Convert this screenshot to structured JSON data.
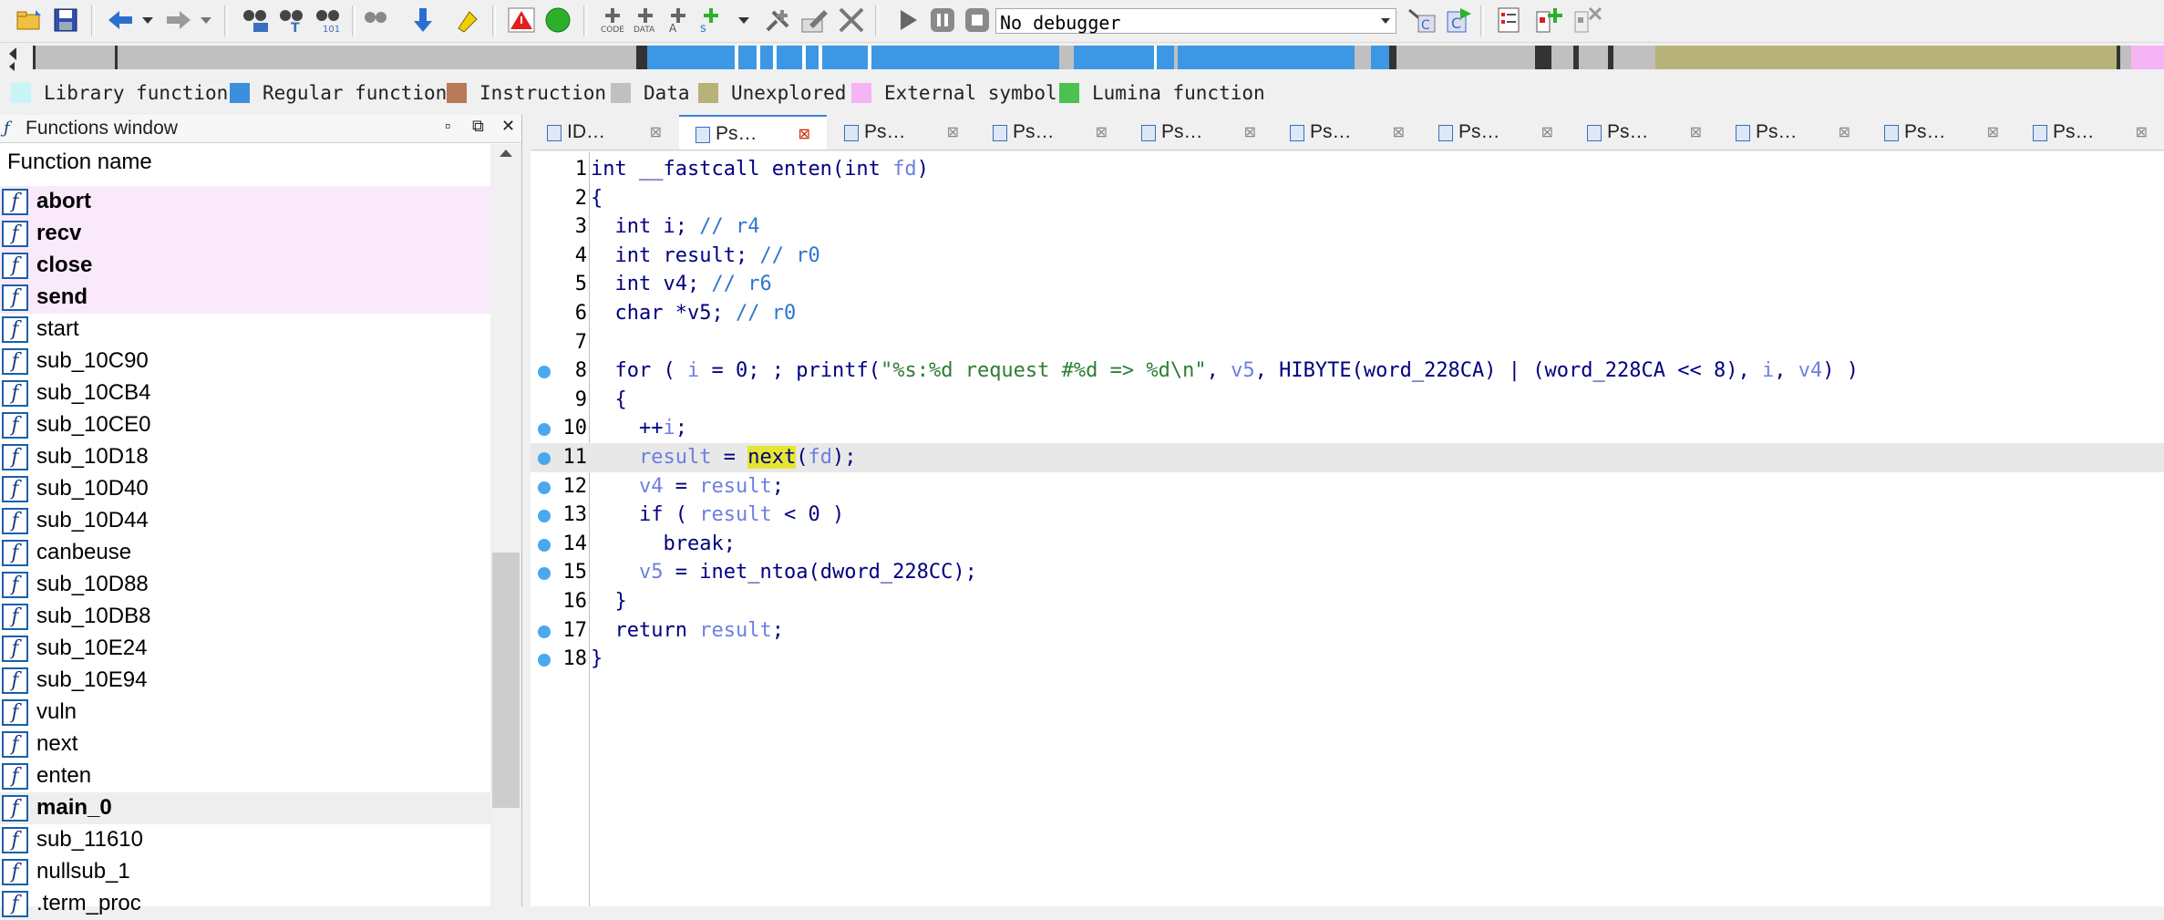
{
  "toolbar": {
    "debugger_select": "No debugger"
  },
  "legend": [
    {
      "label": "Library function",
      "color": "#c8f5f5"
    },
    {
      "label": "Regular function",
      "color": "#3c8fdc"
    },
    {
      "label": "Instruction",
      "color": "#b97a57"
    },
    {
      "label": "Data",
      "color": "#c0c0c0"
    },
    {
      "label": "Unexplored",
      "color": "#b7b27a"
    },
    {
      "label": "External symbol",
      "color": "#f5b5f5"
    },
    {
      "label": "Lumina function",
      "color": "#4cc050"
    }
  ],
  "functions_window": {
    "title": "Functions window",
    "column_header": "Function name",
    "items": [
      {
        "name": "abort",
        "style": "external"
      },
      {
        "name": "recv",
        "style": "external"
      },
      {
        "name": "close",
        "style": "external"
      },
      {
        "name": "send",
        "style": "external"
      },
      {
        "name": "start",
        "style": "normal"
      },
      {
        "name": "sub_10C90",
        "style": "normal"
      },
      {
        "name": "sub_10CB4",
        "style": "normal"
      },
      {
        "name": "sub_10CE0",
        "style": "normal"
      },
      {
        "name": "sub_10D18",
        "style": "normal"
      },
      {
        "name": "sub_10D40",
        "style": "normal"
      },
      {
        "name": "sub_10D44",
        "style": "normal"
      },
      {
        "name": "canbeuse",
        "style": "normal"
      },
      {
        "name": "sub_10D88",
        "style": "normal"
      },
      {
        "name": "sub_10DB8",
        "style": "normal"
      },
      {
        "name": "sub_10E24",
        "style": "normal"
      },
      {
        "name": "sub_10E94",
        "style": "normal"
      },
      {
        "name": "vuln",
        "style": "normal"
      },
      {
        "name": "next",
        "style": "normal"
      },
      {
        "name": "enten",
        "style": "normal"
      },
      {
        "name": "main_0",
        "style": "selected"
      },
      {
        "name": "sub_11610",
        "style": "normal"
      },
      {
        "name": "nullsub_1",
        "style": "normal"
      },
      {
        "name": ".term_proc",
        "style": "normal"
      }
    ]
  },
  "tabs": [
    {
      "label": "ID…",
      "active": false
    },
    {
      "label": "Ps…",
      "active": true
    },
    {
      "label": "Ps…",
      "active": false
    },
    {
      "label": "Ps…",
      "active": false
    },
    {
      "label": "Ps…",
      "active": false
    },
    {
      "label": "Ps…",
      "active": false
    },
    {
      "label": "Ps…",
      "active": false
    },
    {
      "label": "Ps…",
      "active": false
    },
    {
      "label": "Ps…",
      "active": false
    },
    {
      "label": "Ps…",
      "active": false
    },
    {
      "label": "Ps…",
      "active": false
    }
  ],
  "code": {
    "current_line": 11,
    "lines": [
      {
        "n": "1",
        "dot": false,
        "text": "int __fastcall enten(int fd)"
      },
      {
        "n": "2",
        "dot": false,
        "text": "{"
      },
      {
        "n": "3",
        "dot": false,
        "text": "  int i; // r4"
      },
      {
        "n": "4",
        "dot": false,
        "text": "  int result; // r0"
      },
      {
        "n": "5",
        "dot": false,
        "text": "  int v4; // r6"
      },
      {
        "n": "6",
        "dot": false,
        "text": "  char *v5; // r0"
      },
      {
        "n": "7",
        "dot": false,
        "text": ""
      },
      {
        "n": "8",
        "dot": true,
        "text": "  for ( i = 0; ; printf(\"%s:%d request #%d => %d\\n\", v5, HIBYTE(word_228CA) | (word_228CA << 8), i, v4) )"
      },
      {
        "n": "9",
        "dot": false,
        "text": "  {"
      },
      {
        "n": "10",
        "dot": true,
        "text": "    ++i;"
      },
      {
        "n": "11",
        "dot": true,
        "text": "    result = next(fd);"
      },
      {
        "n": "12",
        "dot": true,
        "text": "    v4 = result;"
      },
      {
        "n": "13",
        "dot": true,
        "text": "    if ( result < 0 )"
      },
      {
        "n": "14",
        "dot": true,
        "text": "      break;"
      },
      {
        "n": "15",
        "dot": true,
        "text": "    v5 = inet_ntoa(dword_228CC);"
      },
      {
        "n": "16",
        "dot": false,
        "text": "  }"
      },
      {
        "n": "17",
        "dot": true,
        "text": "  return result;"
      },
      {
        "n": "18",
        "dot": true,
        "text": "}"
      }
    ]
  }
}
